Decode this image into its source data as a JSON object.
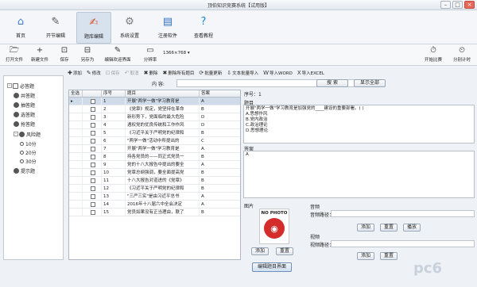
{
  "window": {
    "title": "顶伯知识竞赛系统【试用版】"
  },
  "toolbar_top": [
    {
      "id": "home",
      "label": "首页",
      "icon": "home-icon",
      "glyph": "⌂",
      "color": "#3b7dd8",
      "active": false
    },
    {
      "id": "tools",
      "label": "开节编辑",
      "icon": "wrench-icon",
      "glyph": "✎",
      "color": "#555555",
      "active": false
    },
    {
      "id": "question",
      "label": "题库编辑",
      "icon": "question-edit-icon",
      "glyph": "✍",
      "color": "#d9542b",
      "active": true
    },
    {
      "id": "settings",
      "label": "系统设置",
      "icon": "gear-icon",
      "glyph": "⚙",
      "color": "#7a7a7a",
      "active": false
    },
    {
      "id": "register",
      "label": "注册软件",
      "icon": "register-icon",
      "glyph": "▤",
      "color": "#2f6fc0",
      "active": false
    },
    {
      "id": "tutorial",
      "label": "查看教程",
      "icon": "help-icon",
      "glyph": "?",
      "color": "#1a8ad4",
      "active": false
    }
  ],
  "toolbar_second": [
    {
      "label": "打开文件",
      "icon": "folder-open-icon",
      "glyph": "🗁"
    },
    {
      "label": "新建文件",
      "icon": "new-file-icon",
      "glyph": "+"
    },
    {
      "label": "保存",
      "icon": "save-icon",
      "glyph": "⊡"
    },
    {
      "label": "另存为",
      "icon": "save-as-icon",
      "glyph": "⊟"
    },
    {
      "label": "编辑欢迎界面",
      "icon": "edit-welcome-icon",
      "glyph": "✎"
    },
    {
      "label": "分辨率",
      "icon": "monitor-icon",
      "glyph": "▭"
    }
  ],
  "resolution": "1366×768",
  "toolbar_right": [
    {
      "label": "开始比赛",
      "icon": "start-icon",
      "glyph": "⏱"
    },
    {
      "label": "分别计时",
      "icon": "timer-icon",
      "glyph": "⏲"
    }
  ],
  "tree": {
    "items": [
      {
        "label": "必答题",
        "level": 0,
        "expand": "-"
      },
      {
        "label": "共答题",
        "level": 1
      },
      {
        "label": "抽答题",
        "level": 1
      },
      {
        "label": "选答题",
        "level": 1
      },
      {
        "label": "抢答题",
        "level": 1
      },
      {
        "label": "风险题",
        "level": 1,
        "expand": "-"
      },
      {
        "label": "10分",
        "level": 2
      },
      {
        "label": "20分",
        "level": 2
      },
      {
        "label": "30分",
        "level": 2
      },
      {
        "label": "提示题",
        "level": 1
      }
    ]
  },
  "actions": [
    {
      "label": "添加",
      "glyph": "✚",
      "enabled": true
    },
    {
      "label": "修改",
      "glyph": "✎",
      "enabled": true
    },
    {
      "label": "保存",
      "glyph": "⊡",
      "enabled": false
    },
    {
      "label": "取消",
      "glyph": "↶",
      "enabled": false
    },
    {
      "label": "删除",
      "glyph": "✖",
      "enabled": true
    },
    {
      "label": "删除所有题目",
      "glyph": "✖",
      "enabled": true
    },
    {
      "label": "批量更新",
      "glyph": "⟳",
      "enabled": true
    },
    {
      "label": "文本批量导入",
      "glyph": "⇩",
      "enabled": true
    },
    {
      "label": "导入WORD",
      "glyph": "W",
      "enabled": true
    },
    {
      "label": "导入EXCEL",
      "glyph": "X",
      "enabled": true
    }
  ],
  "search": {
    "label": "内    容:",
    "value": "",
    "search_button": "搜  索",
    "show_all_button": "显示全部"
  },
  "table": {
    "columns": [
      "全选",
      "",
      "序号",
      "题目",
      "答案"
    ],
    "rows": [
      {
        "no": "1",
        "q": "开展\"两学一做\"学习教育是",
        "a": "A"
      },
      {
        "no": "2",
        "q": "《党章》规定，党坚持在革命",
        "a": "B"
      },
      {
        "no": "3",
        "q": "新形势下，党面临的最大危险",
        "a": "D"
      },
      {
        "no": "4",
        "q": "遇权党的优良传统和工作作风",
        "a": "D"
      },
      {
        "no": "5",
        "q": "《习近平关于严明党的纪律和",
        "a": "B"
      },
      {
        "no": "6",
        "q": "\"两学一做\"活动中所提出的",
        "a": "C"
      },
      {
        "no": "7",
        "q": "开展\"两学一做\"学习教育是",
        "a": "A"
      },
      {
        "no": "8",
        "q": "持各党员的——同正式党员一",
        "a": "B"
      },
      {
        "no": "9",
        "q": "党的十八大报告中提出的要全",
        "a": "A"
      },
      {
        "no": "10",
        "q": "党章总纲强调，要全面提高党",
        "a": "B"
      },
      {
        "no": "11",
        "q": "十八大报告对道进的《党章》",
        "a": "B"
      },
      {
        "no": "12",
        "q": "《习近平关于严明党的纪律和",
        "a": "B"
      },
      {
        "no": "13",
        "q": "\"三严三实\"是由习近平总书",
        "a": "A"
      },
      {
        "no": "14",
        "q": "2016年十八届六中全会决定",
        "a": "A"
      },
      {
        "no": "15",
        "q": "党员如果没有正当理由，联了",
        "a": "B"
      }
    ]
  },
  "detail": {
    "seq_label": "序号：",
    "seq_value": "1",
    "question_label": "题目",
    "question_text": "开展\"两学一做\"学习教育是加强党的____建设的重要部署。( )\nA.思想作风\nB.党内政治\nC.政治理论\nD.思想理论",
    "answer_label": "答案",
    "answer_value": "A",
    "image_label": "图片",
    "no_photo": "NO PHOTO",
    "image_add": "添加",
    "image_reset": "重置",
    "audio_label": "音频",
    "audio_path_label": "音频路径：",
    "audio_add": "添加",
    "audio_reset": "重置",
    "audio_play": "播放",
    "video_label": "视频",
    "video_path_label": "视频路径：",
    "video_add": "添加",
    "video_reset": "重置",
    "edit_view_button": "编辑题目界面"
  },
  "watermark": "pc6"
}
